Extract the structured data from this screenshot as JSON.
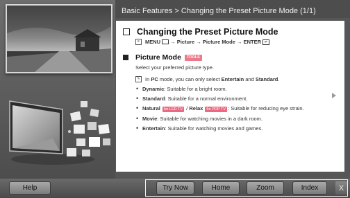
{
  "header": {
    "title": "Basic Features > Changing the Preset Picture Mode (1/1)"
  },
  "section": {
    "title": "Changing the Preset Picture Mode",
    "path": {
      "menu": "MENU",
      "arrow1": "→",
      "picture": "Picture",
      "arrow2": "→",
      "picture_mode": "Picture Mode",
      "arrow3": "→",
      "enter": "ENTER"
    }
  },
  "picture_mode": {
    "title": "Picture Mode",
    "tools_badge": "TOOLS",
    "description": "Select your preferred picture type.",
    "note": {
      "prefix": "In ",
      "pc": "PC",
      "middle": " mode, you can only select ",
      "entertain": "Entertain",
      "and": " and ",
      "standard": "Standard",
      "suffix": "."
    },
    "options": [
      {
        "name": "Dynamic",
        "desc": ": Suitable for a bright room."
      },
      {
        "name": "Standard",
        "desc": ": Suitable for a normal environment."
      },
      {
        "name": "Natural",
        "tag1": "for LED TV",
        "sep": " / ",
        "name2": "Relax",
        "tag2": "for PDP TV",
        "desc": ": Suitable for reducing eye strain."
      },
      {
        "name": "Movie",
        "desc": ": Suitable for watching movies in a dark room."
      },
      {
        "name": "Entertain",
        "desc": ": Suitable for watching movies and games."
      }
    ]
  },
  "footer": {
    "help": "Help",
    "try_now": "Try Now",
    "home": "Home",
    "zoom": "Zoom",
    "index": "Index",
    "close": "X"
  },
  "colors": {
    "badge": "#ec7a8d",
    "background": "#565656",
    "content": "#ffffff"
  },
  "icons": [
    "note-icon",
    "menu-icon",
    "enter-icon",
    "next-arrow-icon"
  ]
}
